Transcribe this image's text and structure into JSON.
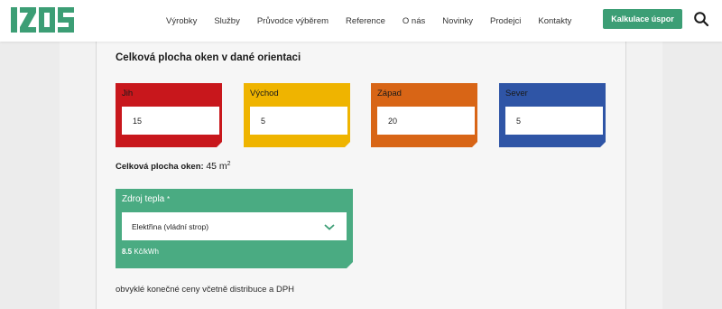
{
  "header": {
    "logo_text": "IZOS",
    "nav": [
      "Výrobky",
      "Služby",
      "Průvodce výběrem",
      "Reference",
      "O nás",
      "Novinky",
      "Prodejci",
      "Kontakty"
    ],
    "cta_label": "Kalkulace úspor"
  },
  "form": {
    "section_title": "Celková plocha oken v dané orientaci",
    "orientations": [
      {
        "label": "Jih",
        "value": "15",
        "color": "#c8171c"
      },
      {
        "label": "Východ",
        "value": "5",
        "color": "#efb400"
      },
      {
        "label": "Západ",
        "value": "20",
        "color": "#d86516"
      },
      {
        "label": "Sever",
        "value": "5",
        "color": "#2f55a6"
      }
    ],
    "total_label": "Celková plocha oken:",
    "total_value": "45 m",
    "total_unit_sup": "2",
    "heat_source": {
      "label": "Zdroj tepla",
      "required_mark": "*",
      "selected": "Elektřina (vládní strop)",
      "price_value": "8.5",
      "price_unit": "Kč/kWh",
      "color": "#4aab82"
    },
    "note": "obvyklé konečné ceny včetně distribuce a DPH"
  },
  "icons": {
    "search": "search-icon",
    "chevron": "chevron-down-icon"
  }
}
